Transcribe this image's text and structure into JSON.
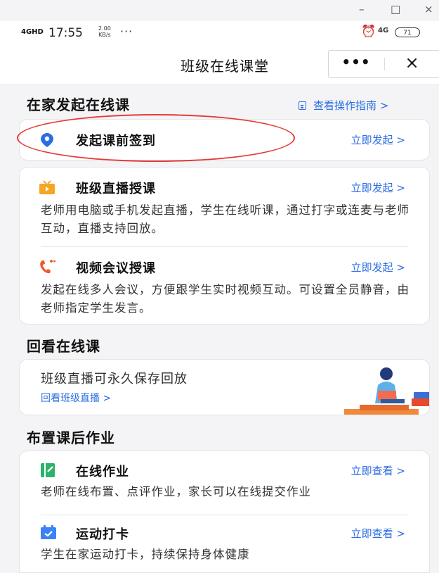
{
  "window": {
    "minimize": "–",
    "maximize": "□",
    "close": "×"
  },
  "status": {
    "network": "4GHD",
    "time": "17:55",
    "speed_value": "2.00",
    "speed_unit": "KB/s",
    "more": "···",
    "alarm": "⏰",
    "signal": "4G",
    "battery": "71"
  },
  "titlebar": {
    "title": "班级在线课堂",
    "more": "•••",
    "close": "×"
  },
  "section1": {
    "title": "在家发起在线课",
    "guide": "查看操作指南 >",
    "checkin": {
      "title": "发起课前签到",
      "action": "立即发起 >"
    },
    "live": {
      "title": "班级直播授课",
      "action": "立即发起 >",
      "desc": "老师用电脑或手机发起直播，学生在线听课，通过打字或连麦与老师互动，直播支持回放。"
    },
    "meeting": {
      "title": "视频会议授课",
      "action": "立即发起 >",
      "desc": "发起在线多人会议，方便跟学生实时视频互动。可设置全员静音，由老师指定学生发言。"
    }
  },
  "section2": {
    "title": "回看在线课",
    "card_title": "班级直播可永久保存回放",
    "link": "回看班级直播 >"
  },
  "section3": {
    "title": "布置课后作业",
    "homework": {
      "title": "在线作业",
      "action": "立即查看 >",
      "desc": "老师在线布置、点评作业，家长可以在线提交作业"
    },
    "exercise": {
      "title": "运动打卡",
      "action": "立即查看 >",
      "desc": "学生在家运动打卡，持续保持身体健康"
    }
  },
  "colors": {
    "accent": "#2b6de3",
    "annotation": "#e53935",
    "live_icon": "#f5a623",
    "meeting_icon": "#ee5a2b",
    "homework_icon": "#2bb36a",
    "exercise_icon": "#3b82f6"
  }
}
